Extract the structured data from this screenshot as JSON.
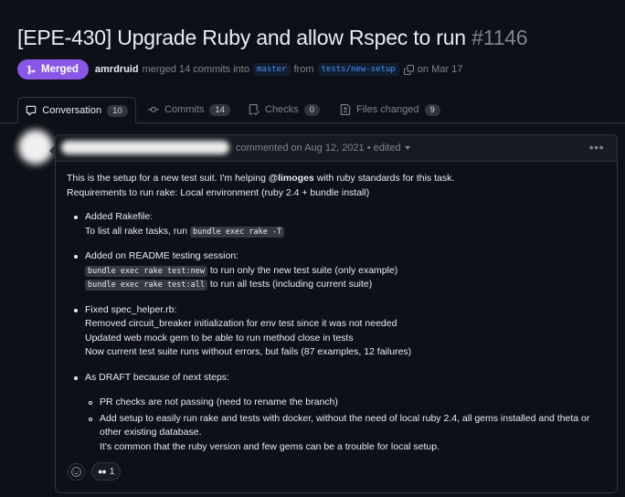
{
  "pr": {
    "title": "[EPE-430] Upgrade Ruby and allow Rspec to run",
    "number": "#1146",
    "status": "Merged",
    "author": "amrdruid",
    "merge_text": "merged 14 commits into",
    "base_branch": "master",
    "from_text": "from",
    "head_branch": "tests/new-setup",
    "date_text": "on Mar 17"
  },
  "tabs": [
    {
      "label": "Conversation",
      "count": "10",
      "icon": "comment-icon"
    },
    {
      "label": "Commits",
      "count": "14",
      "icon": "commit-icon"
    },
    {
      "label": "Checks",
      "count": "0",
      "icon": "checklist-icon"
    },
    {
      "label": "Files changed",
      "count": "9",
      "icon": "file-diff-icon"
    }
  ],
  "comment": {
    "header_text": "commented on Aug 12, 2021 • edited",
    "line1_pre": "This is the setup for a new test suit. I'm helping ",
    "mention": "@limoges",
    "line1_post": " with ruby standards for this task.",
    "line2": "Requirements to run rake: Local environment (ruby 2.4 + bundle install)",
    "bullet1_title": "Added Rakefile:",
    "bullet1_text": "To list all rake tasks, run ",
    "bullet1_code": "bundle exec rake -T",
    "bullet2_title": "Added on README testing session:",
    "bullet2_code1": "bundle exec rake test:new",
    "bullet2_text1": " to run only the new test suite (only example)",
    "bullet2_code2": "bundle exec rake test:all",
    "bullet2_text2": " to run all tests (including current suite)",
    "bullet3_title": "Fixed spec_helper.rb:",
    "bullet3_line1": "Removed circuit_breaker initialization for env test since it was not needed",
    "bullet3_line2": "Updated web mock gem to be able to run method close in tests",
    "bullet3_line3": "Now current test suite runs without errors, but fails (87 examples, 12 failures)",
    "bullet4_title": "As DRAFT because of next steps:",
    "sub1": "PR checks are not passing (need to rename the branch)",
    "sub2_line1": "Add setup to easily run rake and tests with docker, without the need of local ruby 2.4, all gems installed and theta or",
    "sub2_line2": "other existing database.",
    "sub2_line3": "It's common that the ruby version and few gems can be a trouble for local setup."
  },
  "reactions": [
    {
      "emoji": "👀",
      "count": "1"
    }
  ],
  "colors": {
    "background": "#0d1117",
    "merged_badge": "#8957e5",
    "link": "#4493f8",
    "border": "#30363d"
  }
}
